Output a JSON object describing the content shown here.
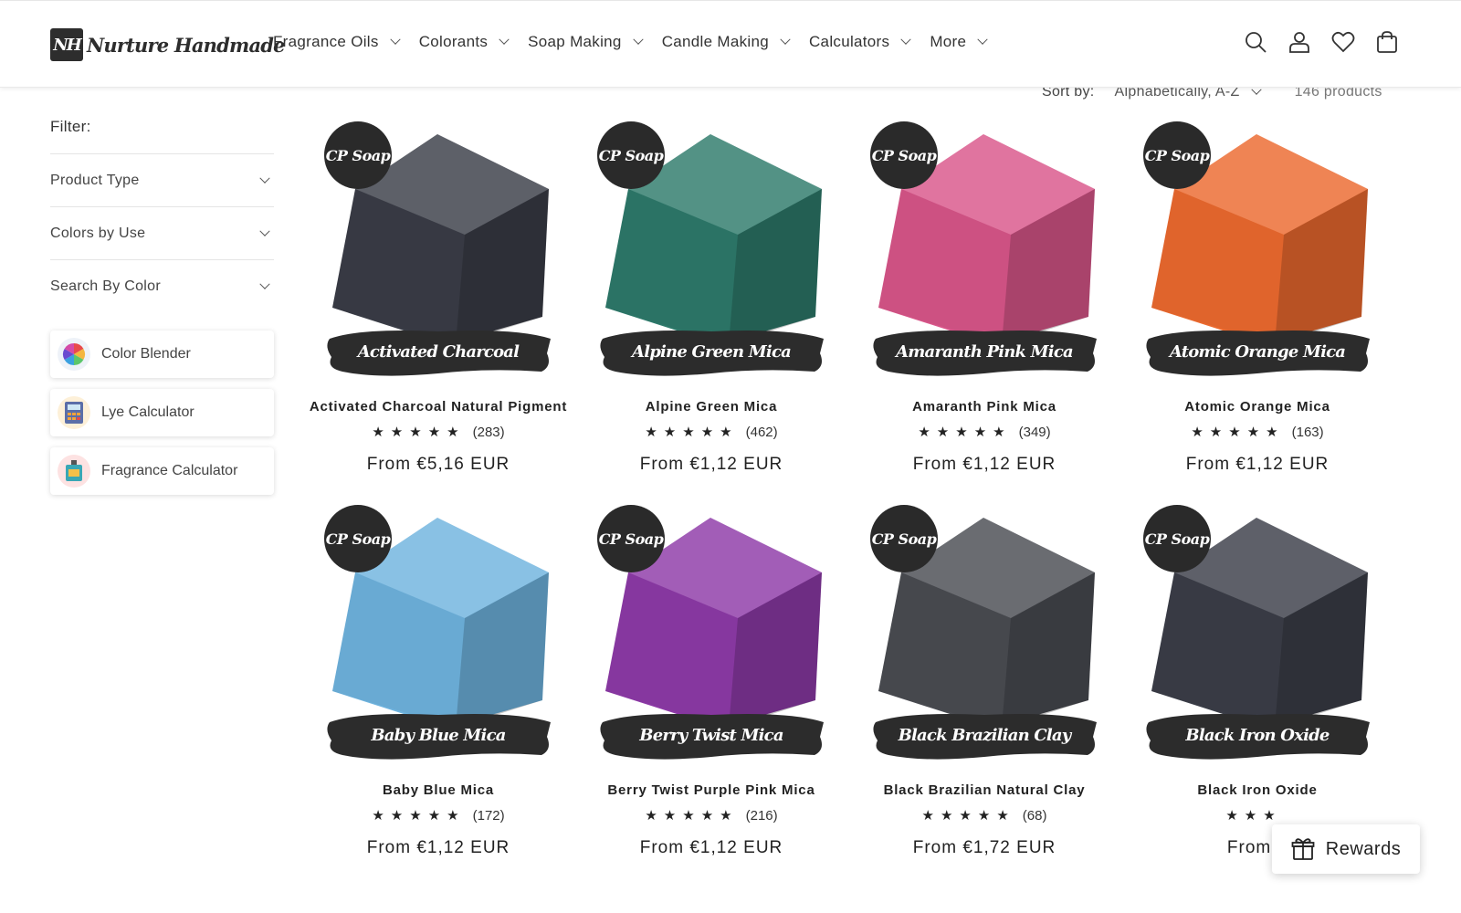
{
  "brand": {
    "mark": "NH",
    "name": "Nurture Handmade"
  },
  "nav": [
    {
      "label": "Fragrance Oils"
    },
    {
      "label": "Colorants"
    },
    {
      "label": "Soap Making"
    },
    {
      "label": "Candle Making"
    },
    {
      "label": "Calculators"
    },
    {
      "label": "More"
    }
  ],
  "header_icons": [
    "search-icon",
    "account-icon",
    "wishlist-heart-icon",
    "cart-icon"
  ],
  "sort": {
    "label": "Sort by:",
    "value": "Alphabetically, A-Z",
    "count": "146 products"
  },
  "filter": {
    "title": "Filter:",
    "groups": [
      {
        "label": "Product Type"
      },
      {
        "label": "Colors by Use"
      },
      {
        "label": "Search By Color"
      }
    ],
    "tools": [
      {
        "label": "Color Blender",
        "icon": "color-wheel-icon"
      },
      {
        "label": "Lye Calculator",
        "icon": "calculator-icon"
      },
      {
        "label": "Fragrance Calculator",
        "icon": "fragrance-bottle-icon"
      }
    ]
  },
  "badge_text": "CP Soap",
  "products": [
    {
      "banner": "Activated Charcoal",
      "title": "Activated Charcoal Natural Pigment",
      "stars": "★★★★★",
      "reviews": "(283)",
      "price": "From €5,16 EUR",
      "color": "#3a3d47"
    },
    {
      "banner": "Alpine Green Mica",
      "title": "Alpine Green Mica",
      "stars": "★★★★★",
      "reviews": "(462)",
      "price": "From €1,12 EUR",
      "color": "#2e7a6b"
    },
    {
      "banner": "Amaranth Pink Mica",
      "title": "Amaranth Pink Mica",
      "stars": "★★★★★",
      "reviews": "(349)",
      "price": "From €1,12 EUR",
      "color": "#d9568a"
    },
    {
      "banner": "Atomic Orange Mica",
      "title": "Atomic Orange Mica",
      "stars": "★★★★★",
      "reviews": "(163)",
      "price": "From €1,12 EUR",
      "color": "#ec6a2f"
    },
    {
      "banner": "Baby Blue Mica",
      "title": "Baby Blue Mica",
      "stars": "★★★★★",
      "reviews": "(172)",
      "price": "From €1,12 EUR",
      "color": "#6fb4df"
    },
    {
      "banner": "Berry Twist Mica",
      "title": "Berry Twist Purple Pink Mica",
      "stars": "★★★★★",
      "reviews": "(216)",
      "price": "From €1,12 EUR",
      "color": "#8e3aa8"
    },
    {
      "banner": "Black Brazilian Clay",
      "title": "Black Brazilian Natural Clay",
      "stars": "★★★★★",
      "reviews": "(68)",
      "price": "From €1,72 EUR",
      "color": "#4a4c52"
    },
    {
      "banner": "Black Iron Oxide",
      "title": "Black Iron Oxide",
      "stars": "★★★",
      "reviews": "",
      "price": "From €",
      "color": "#3b3e48"
    }
  ],
  "rewards": {
    "label": "Rewards"
  }
}
